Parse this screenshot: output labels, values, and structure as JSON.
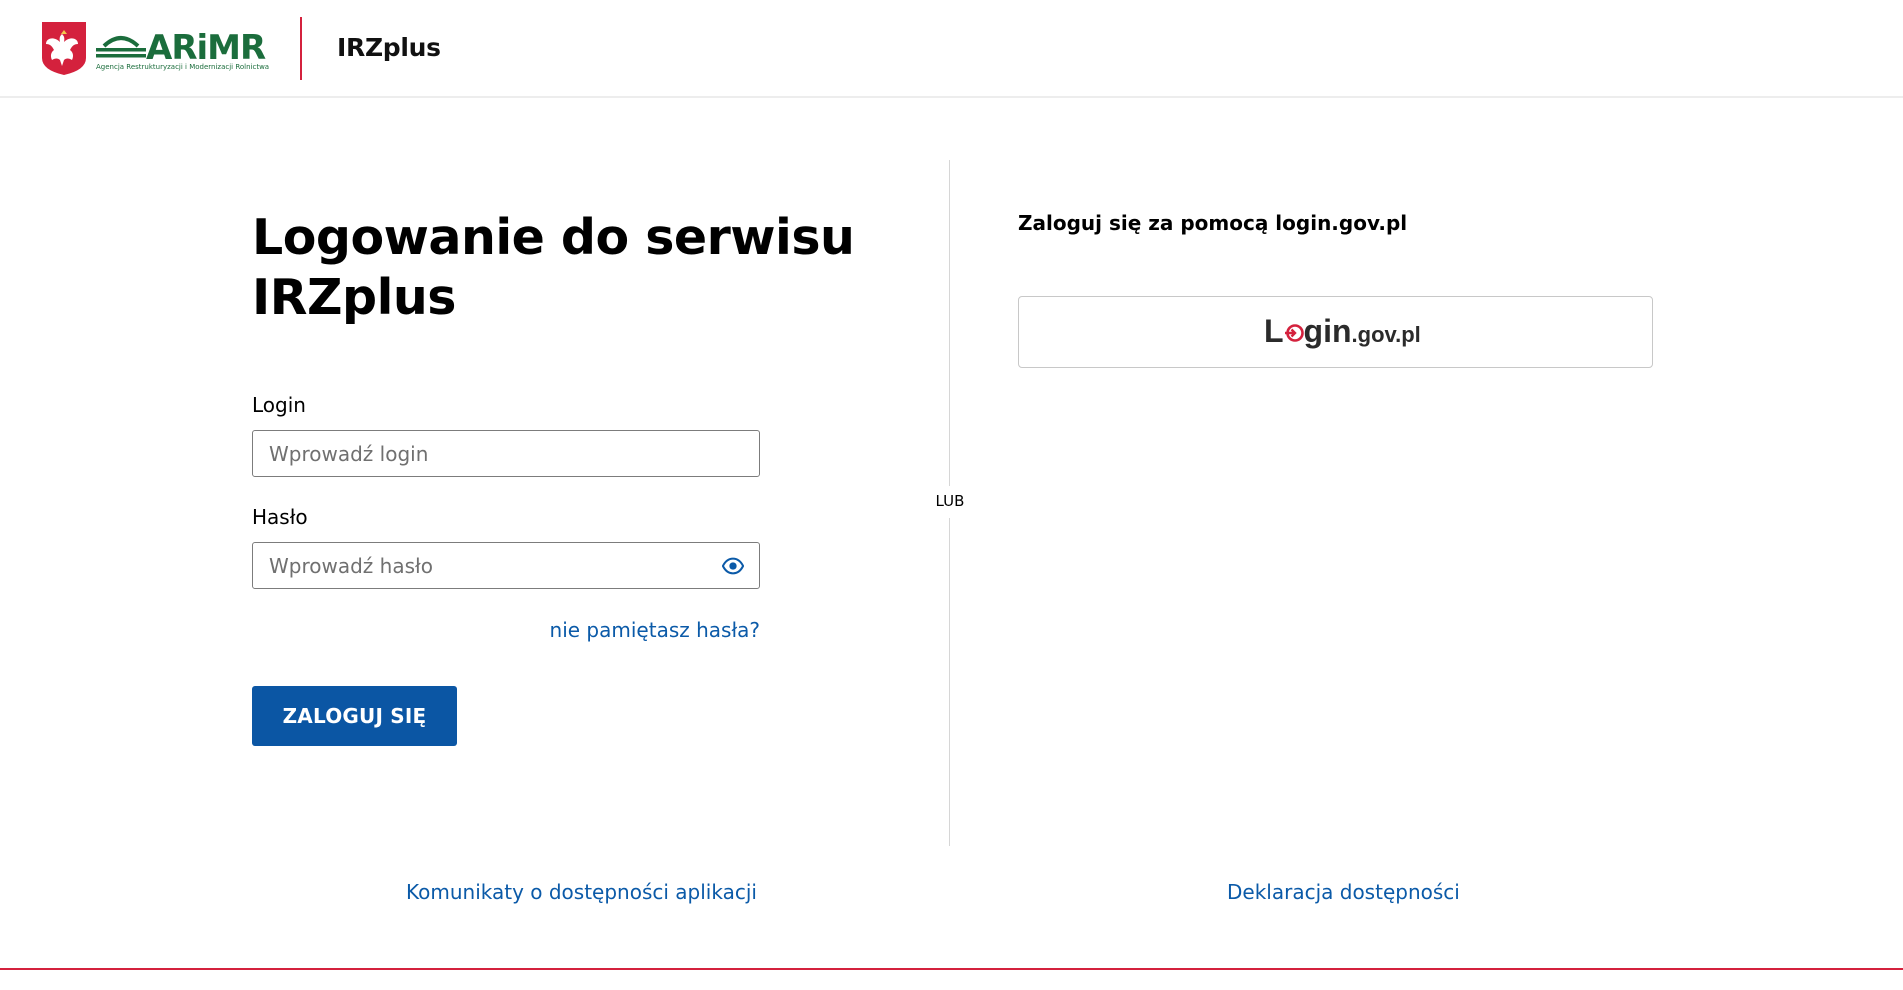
{
  "header": {
    "logo_word": "ARiMR",
    "logo_subtitle": "Agencja Restrukturyzacji i Modernizacji Rolnictwa",
    "app_name": "IRZplus"
  },
  "login_form": {
    "title": "Logowanie do serwisu IRZplus",
    "login_label": "Login",
    "login_placeholder": "Wprowadź login",
    "login_value": "",
    "password_label": "Hasło",
    "password_placeholder": "Wprowadź hasło",
    "password_value": "",
    "password_toggle_icon": "eye-icon",
    "forgot_password": "nie pamiętasz hasła?",
    "submit_label": "ZALOGUJ SIĘ"
  },
  "separator": {
    "text": "LUB"
  },
  "alternative_login": {
    "heading": "Zaloguj się za pomocą login.gov.pl",
    "logo": {
      "part1": "L",
      "part2": "gin",
      "part3": ".gov.pl"
    }
  },
  "footer": {
    "accessibility_messages": "Komunikaty o dostępności aplikacji",
    "accessibility_declaration": "Deklaracja dostępności"
  },
  "colors": {
    "accent_blue": "#0b56a4",
    "link_blue": "#0b5aa8",
    "brand_red": "#d4213d",
    "arimr_green": "#1b6d3c"
  }
}
